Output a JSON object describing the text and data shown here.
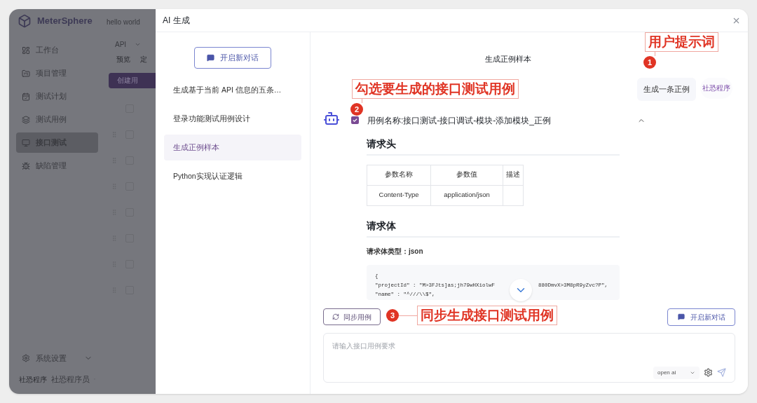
{
  "app": {
    "brand": "MeterSphere",
    "project": "hello world",
    "nav": [
      {
        "label": "工作台",
        "selected": false
      },
      {
        "label": "项目管理",
        "selected": false
      },
      {
        "label": "测试计划",
        "selected": false
      },
      {
        "label": "测试用例",
        "selected": false
      },
      {
        "label": "接口测试",
        "selected": true
      },
      {
        "label": "缺陷管理",
        "selected": false
      }
    ],
    "settings": "系统设置",
    "user": {
      "avatar": "社恐程序",
      "name": "社恐程序员"
    },
    "content": {
      "select": "API",
      "tabs": [
        "预览",
        "定"
      ],
      "create_button": "创建用",
      "rows": [
        {
          "checked": false
        },
        {
          "checked": false
        },
        {
          "checked": false
        },
        {
          "checked": false
        },
        {
          "checked": false
        },
        {
          "checked": false
        },
        {
          "checked": false
        },
        {
          "checked": false
        }
      ]
    }
  },
  "drawer": {
    "title": "AI 生成",
    "new_chat": "开启新对话",
    "history": [
      {
        "label": "生成基于当前 API 信息的五条…",
        "selected": false
      },
      {
        "label": "登录功能测试用例设计",
        "selected": false
      },
      {
        "label": "生成正例样本",
        "selected": true
      },
      {
        "label": "Python实现认证逻辑",
        "selected": false
      }
    ],
    "chat_title": "生成正例样本",
    "user_message": {
      "text": "生成一条正例",
      "avatar": "社恐程序"
    },
    "case": {
      "checked": true,
      "name": "用例名称:接口测试-接口调试-模块-添加模块_正例",
      "expanded": true,
      "headers_title": "请求头",
      "columns": [
        "参数名称",
        "参数值",
        "描述"
      ],
      "rows": [
        [
          "Content-Type",
          "application/json",
          ""
        ]
      ],
      "body_title": "请求体",
      "body_type_label": "请求体类型：",
      "body_type": "json",
      "code": [
        [
          "{"
        ],
        [
          "\"projectId\" : \"M>3FJts]as;jh79wHXiolwF",
          "880DmvX>3M8pR9yZvc?P\","
        ],
        [
          "\"name\" : \"^///\\\\$\","
        ]
      ]
    },
    "sync_button": "同步用例",
    "new_chat_bottom": "开启新对话",
    "input": {
      "placeholder": "请输入接口用例要求",
      "model": "open ai"
    }
  },
  "annotations": [
    {
      "number": "1",
      "label": "用户提示词"
    },
    {
      "number": "2",
      "label": "勾选要生成的接口测试用例"
    },
    {
      "number": "3",
      "label": "同步生成接口测试用例"
    }
  ]
}
